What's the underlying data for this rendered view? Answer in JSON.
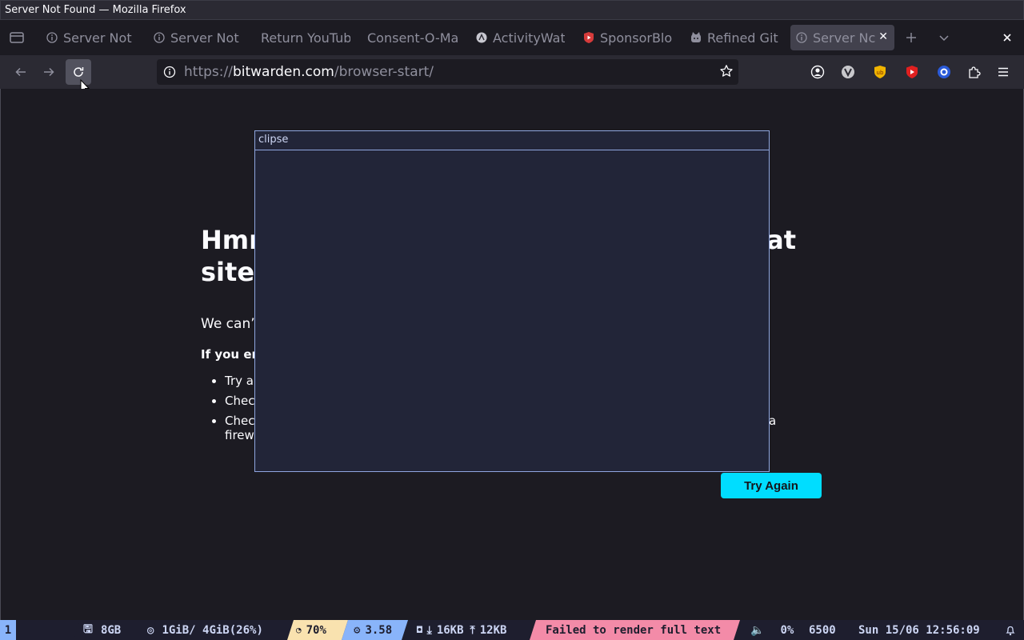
{
  "window": {
    "title": "Server Not Found — Mozilla Firefox"
  },
  "tabs": [
    {
      "label": "Server Not",
      "icon": "info-icon"
    },
    {
      "label": "Server Not",
      "icon": "info-icon"
    },
    {
      "label": "Return YouTub",
      "icon": "none"
    },
    {
      "label": "Consent-O-Ma",
      "icon": "none"
    },
    {
      "label": "ActivityWat",
      "icon": "activitywatch-icon"
    },
    {
      "label": "SponsorBlo",
      "icon": "sponsorblock-icon"
    },
    {
      "label": "Refined Git",
      "icon": "github-icon"
    },
    {
      "label": "Server Nc",
      "icon": "info-icon",
      "active": true
    }
  ],
  "urlbar": {
    "scheme": "https://",
    "host": "bitwarden.com",
    "path": "/browser-start/"
  },
  "error": {
    "title_line1": "Hmm. We’re having trouble finding that",
    "title_line2": "site.",
    "description": "We can’t connect to the server at bitwarden.com.",
    "hint": "If you entered the right address, you can:",
    "items": [
      "Try again later.",
      "Check your network connection.",
      "Check that Firefox has permission to access the web (you might be connected but behind a firewall)."
    ],
    "title_line1_visible_start": "Hmr",
    "title_line1_visible_end": "at",
    "title_line2_visible": "site",
    "description_visible": "We can’",
    "hint_visible": "If you er",
    "items_visible": [
      "Try a",
      "Chec",
      "Chec"
    ],
    "item3_tail": "a",
    "item3_line2": "firew",
    "try_again": "Try Again"
  },
  "popup": {
    "title": "clipse"
  },
  "statusbar": {
    "workspace": "1",
    "disk": "8GB",
    "memory": "1GiB/ 4GiB(26%)",
    "battery": "70%",
    "load": "3.58",
    "net_down": "16KB",
    "net_up": "12KB",
    "error_text": "Failed to render full text",
    "volume": "0%",
    "temperature": "6500",
    "datetime": "Sun 15/06 12:56:09",
    "colors": {
      "blue": "#89b4fa",
      "yellow": "#f9e2af",
      "red": "#f38ba8",
      "bg": "#1e1e2e"
    }
  }
}
